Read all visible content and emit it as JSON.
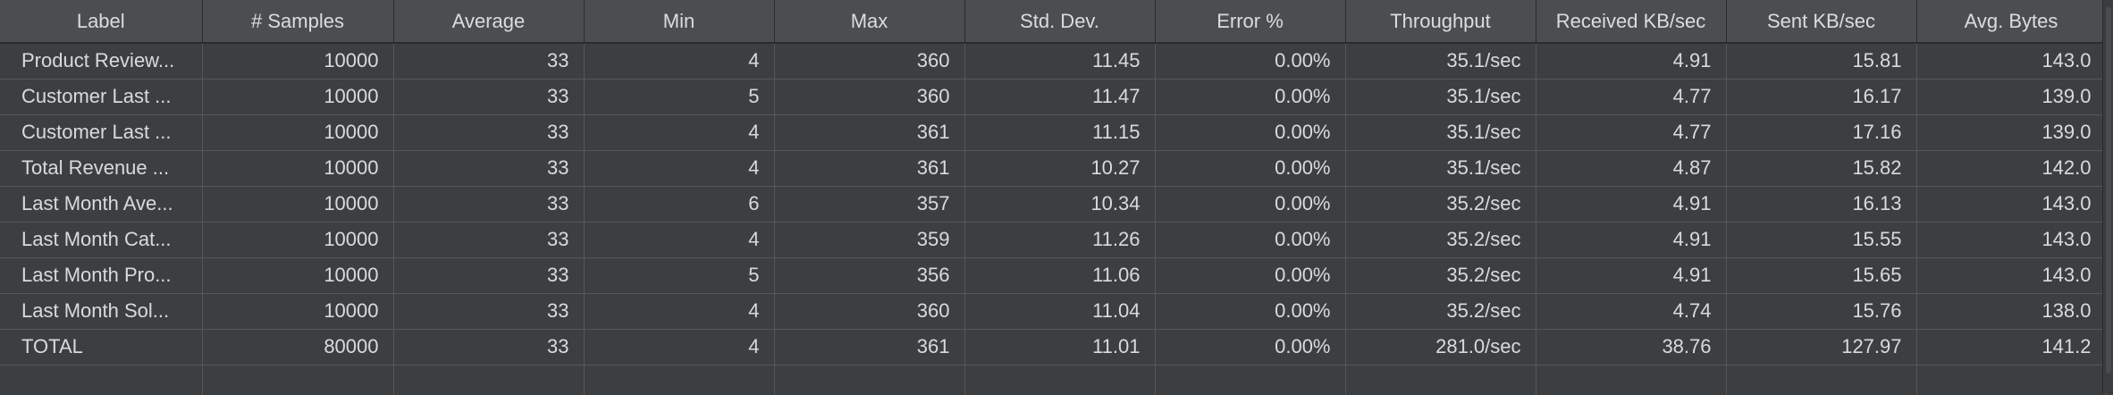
{
  "columns": [
    "Label",
    "# Samples",
    "Average",
    "Min",
    "Max",
    "Std. Dev.",
    "Error %",
    "Throughput",
    "Received KB/sec",
    "Sent KB/sec",
    "Avg. Bytes"
  ],
  "rows": [
    [
      "Product Review...",
      "10000",
      "33",
      "4",
      "360",
      "11.45",
      "0.00%",
      "35.1/sec",
      "4.91",
      "15.81",
      "143.0"
    ],
    [
      "Customer Last ...",
      "10000",
      "33",
      "5",
      "360",
      "11.47",
      "0.00%",
      "35.1/sec",
      "4.77",
      "16.17",
      "139.0"
    ],
    [
      "Customer Last ...",
      "10000",
      "33",
      "4",
      "361",
      "11.15",
      "0.00%",
      "35.1/sec",
      "4.77",
      "17.16",
      "139.0"
    ],
    [
      "Total Revenue ...",
      "10000",
      "33",
      "4",
      "361",
      "10.27",
      "0.00%",
      "35.1/sec",
      "4.87",
      "15.82",
      "142.0"
    ],
    [
      "Last Month Ave...",
      "10000",
      "33",
      "6",
      "357",
      "10.34",
      "0.00%",
      "35.2/sec",
      "4.91",
      "16.13",
      "143.0"
    ],
    [
      "Last Month Cat...",
      "10000",
      "33",
      "4",
      "359",
      "11.26",
      "0.00%",
      "35.2/sec",
      "4.91",
      "15.55",
      "143.0"
    ],
    [
      "Last Month Pro...",
      "10000",
      "33",
      "5",
      "356",
      "11.06",
      "0.00%",
      "35.2/sec",
      "4.91",
      "15.65",
      "143.0"
    ],
    [
      "Last Month Sol...",
      "10000",
      "33",
      "4",
      "360",
      "11.04",
      "0.00%",
      "35.2/sec",
      "4.74",
      "15.76",
      "138.0"
    ],
    [
      "TOTAL",
      "80000",
      "33",
      "4",
      "361",
      "11.01",
      "0.00%",
      "281.0/sec",
      "38.76",
      "127.97",
      "141.2"
    ]
  ]
}
